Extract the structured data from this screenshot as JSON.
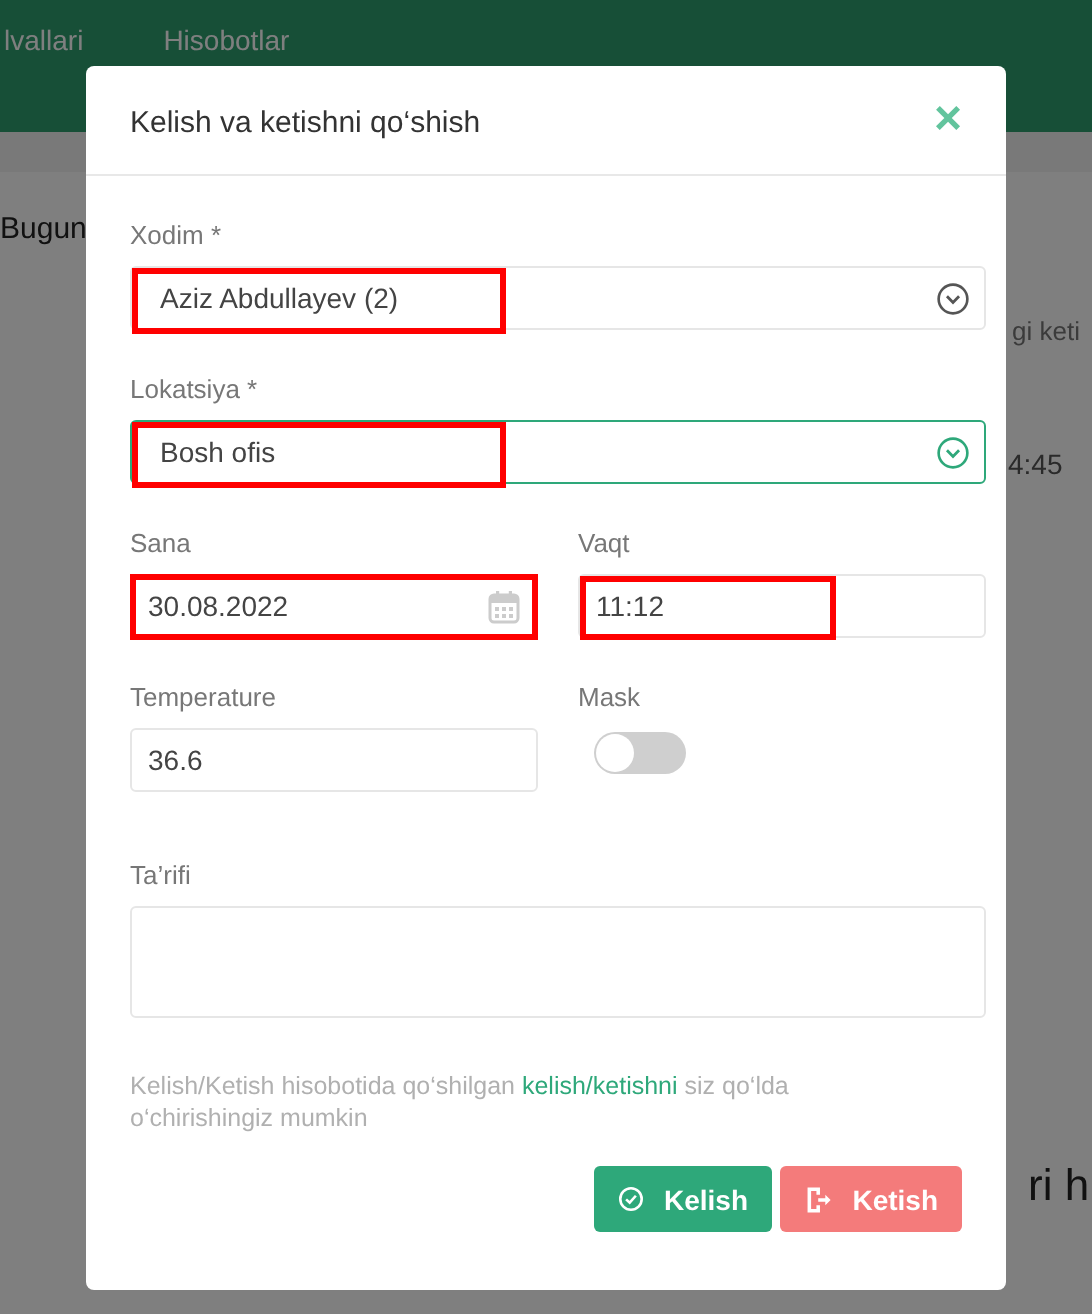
{
  "background": {
    "nav": [
      "lvallari",
      "Hisobotlar"
    ],
    "fragments": [
      "Bugun",
      "gi keti",
      "4:45",
      "ri h"
    ]
  },
  "dialog": {
    "title": "Kelish va ketishni qo‘shish",
    "close": "×",
    "fields": [
      {
        "kind": "select",
        "label": "Xodim *",
        "value": "Aziz Abdullayev (2)",
        "highlighted": true,
        "focused": false
      },
      {
        "kind": "select",
        "label": "Lokatsiya *",
        "value": "Bosh ofis",
        "highlighted": true,
        "focused": true
      },
      {
        "kind": "date",
        "label": "Sana",
        "value": "30.08.2022",
        "highlighted": true,
        "focused": false
      },
      {
        "kind": "time",
        "label": "Vaqt",
        "value": "11:12",
        "highlighted": true,
        "focused": false
      },
      {
        "kind": "text",
        "label": "Temperature",
        "value": "36.6",
        "highlighted": false,
        "focused": false
      },
      {
        "kind": "toggle",
        "label": "Mask",
        "on": false
      },
      {
        "kind": "textarea",
        "label": "Ta’rifi",
        "highlighted": false,
        "focused": false
      }
    ],
    "note": {
      "before": "Kelish/Ketish hisobotida qo‘shilgan",
      "link": "kelish/ketishni",
      "after": "siz qo‘lda o‘chirishingiz mumkin"
    },
    "buttons": [
      {
        "kind": "arrive",
        "label": "Kelish"
      },
      {
        "kind": "leave",
        "label": "Ketish"
      }
    ]
  }
}
